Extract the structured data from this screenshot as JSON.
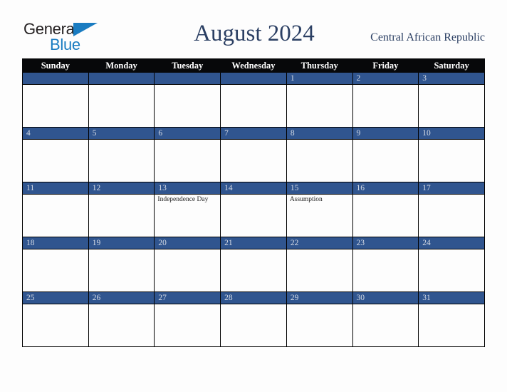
{
  "brand": {
    "name_part1": "General",
    "name_part2": "Blue",
    "triangle_icon": "blue-triangle-icon",
    "accent_color": "#1a7cc1",
    "text_color": "#231f20"
  },
  "header": {
    "title": "August 2024",
    "country": "Central African Republic"
  },
  "theme": {
    "header_bg": "#07080a",
    "day_bar_blue": "#30558f",
    "day_number_color": "#d7dce6",
    "title_color": "#2b3f63",
    "page_bg": "#fdfdfd",
    "grid_line": "#000000"
  },
  "calendar": {
    "month": "August",
    "year": "2024",
    "weekday_headers": [
      "Sunday",
      "Monday",
      "Tuesday",
      "Wednesday",
      "Thursday",
      "Friday",
      "Saturday"
    ],
    "weeks": [
      [
        {
          "day": "",
          "events": []
        },
        {
          "day": "",
          "events": []
        },
        {
          "day": "",
          "events": []
        },
        {
          "day": "",
          "events": []
        },
        {
          "day": "1",
          "events": []
        },
        {
          "day": "2",
          "events": []
        },
        {
          "day": "3",
          "events": []
        }
      ],
      [
        {
          "day": "4",
          "events": []
        },
        {
          "day": "5",
          "events": []
        },
        {
          "day": "6",
          "events": []
        },
        {
          "day": "7",
          "events": []
        },
        {
          "day": "8",
          "events": []
        },
        {
          "day": "9",
          "events": []
        },
        {
          "day": "10",
          "events": []
        }
      ],
      [
        {
          "day": "11",
          "events": []
        },
        {
          "day": "12",
          "events": []
        },
        {
          "day": "13",
          "events": [
            "Independence Day"
          ]
        },
        {
          "day": "14",
          "events": []
        },
        {
          "day": "15",
          "events": [
            "Assumption"
          ]
        },
        {
          "day": "16",
          "events": []
        },
        {
          "day": "17",
          "events": []
        }
      ],
      [
        {
          "day": "18",
          "events": []
        },
        {
          "day": "19",
          "events": []
        },
        {
          "day": "20",
          "events": []
        },
        {
          "day": "21",
          "events": []
        },
        {
          "day": "22",
          "events": []
        },
        {
          "day": "23",
          "events": []
        },
        {
          "day": "24",
          "events": []
        }
      ],
      [
        {
          "day": "25",
          "events": []
        },
        {
          "day": "26",
          "events": []
        },
        {
          "day": "27",
          "events": []
        },
        {
          "day": "28",
          "events": []
        },
        {
          "day": "29",
          "events": []
        },
        {
          "day": "30",
          "events": []
        },
        {
          "day": "31",
          "events": []
        }
      ]
    ]
  }
}
